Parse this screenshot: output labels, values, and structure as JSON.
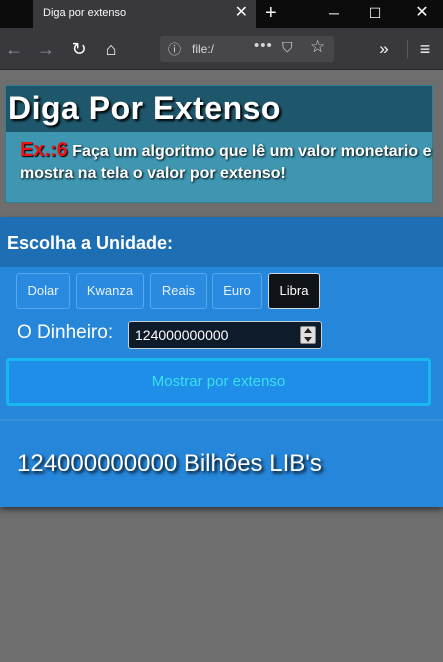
{
  "browser": {
    "tab_title": "Diga por extenso",
    "tab_close_icon": "close-icon",
    "url_text": "file:/",
    "icons": {
      "back": "arrow-left-icon",
      "forward": "arrow-right-icon",
      "reload": "reload-icon",
      "home": "home-icon",
      "info": "info-icon",
      "more": "more-dots-icon",
      "pocket": "pocket-icon",
      "star": "star-icon",
      "overflow": "overflow-icon",
      "menu": "menu-icon"
    }
  },
  "header": {
    "title": "Diga Por Extenso",
    "exercise_number": "Ex.:6",
    "exercise_description": "Faça um algoritmo que lê um valor monetario e mostra na tela o valor por extenso!"
  },
  "panel": {
    "title": "Escolha a Unidade:",
    "units": [
      {
        "label": "Dolar",
        "selected": false
      },
      {
        "label": "Kwanza",
        "selected": false
      },
      {
        "label": "Reais",
        "selected": false
      },
      {
        "label": "Euro",
        "selected": false
      },
      {
        "label": "Libra",
        "selected": true
      }
    ],
    "money_label": "O Dinheiro:",
    "money_value": "124000000000",
    "show_button_label": "Mostrar por extenso",
    "result_text": "124000000000 Bilhões LIB's"
  },
  "colors": {
    "header_bar": "#1e566c",
    "header_box": "#3f96b1",
    "exercise_number": "#ee1111",
    "panel": "#2686da",
    "panel_head": "#1e6eb3",
    "show_button_text": "#38e0f0",
    "page_background": "#6e6e6e"
  }
}
